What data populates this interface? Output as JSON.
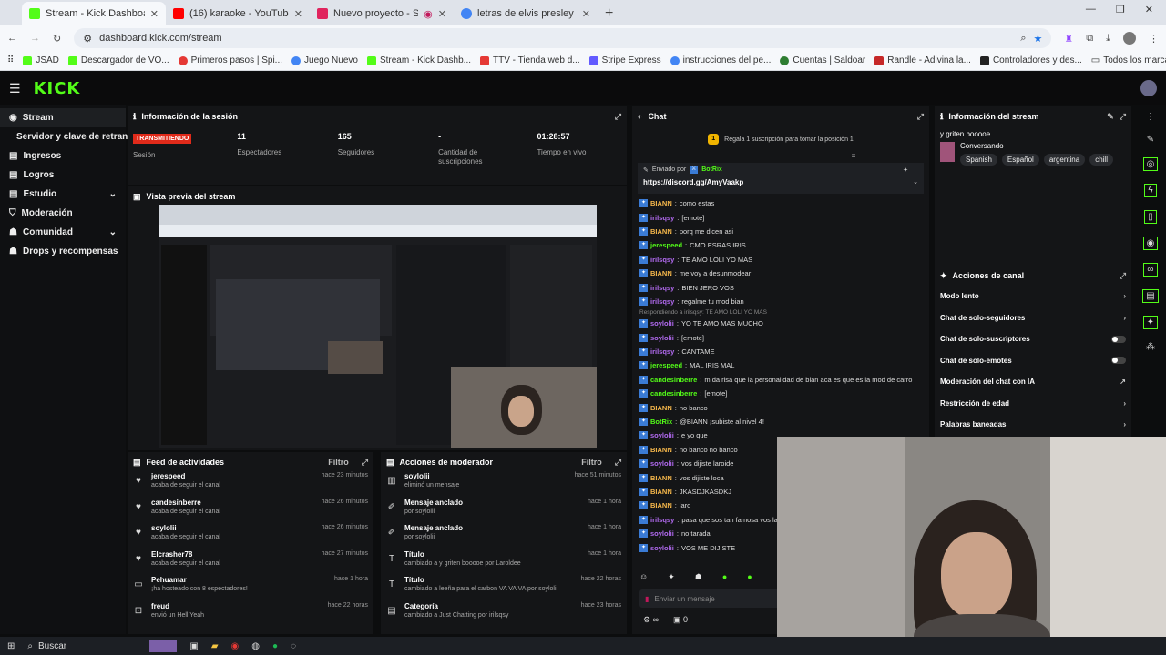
{
  "browser": {
    "tabs": [
      {
        "title": "Stream - Kick Dashboard",
        "color": "#53fc18",
        "active": true
      },
      {
        "title": "(16) karaoke - YouTube",
        "color": "#ff0000",
        "active": false
      },
      {
        "title": "Nuevo proyecto - Studio",
        "color": "#e0245e",
        "active": false
      },
      {
        "title": "letras de elvis presley can't help",
        "color": "#4285f4",
        "active": false
      }
    ],
    "url": "dashboard.kick.com/stream",
    "bookmarks": [
      "JSAD",
      "Descargador de VO...",
      "Primeros pasos | Spi...",
      "Juego Nuevo",
      "Stream - Kick Dashb...",
      "TTV - Tienda web d...",
      "Stripe Express",
      "instrucciones del pe...",
      "Cuentas | Saldoar",
      "Randle - Adivina la...",
      "Controladores y des..."
    ],
    "all_bookmarks": "Todos los marcadores"
  },
  "sidebar": {
    "items": [
      {
        "label": "Stream",
        "active": true,
        "chevron": false
      },
      {
        "label": "Servidor y clave de retransm",
        "active": false,
        "chevron": false
      },
      {
        "label": "Ingresos",
        "active": false,
        "chevron": false
      },
      {
        "label": "Logros",
        "active": false,
        "chevron": false
      },
      {
        "label": "Estudio",
        "active": false,
        "chevron": true
      },
      {
        "label": "Moderación",
        "active": false,
        "chevron": false
      },
      {
        "label": "Comunidad",
        "active": false,
        "chevron": true
      },
      {
        "label": "Drops y recompensas",
        "active": false,
        "chevron": false
      }
    ]
  },
  "session": {
    "title": "Información de la sesión",
    "live_badge": "TRANSMITIENDO",
    "session_label": "Sesión",
    "stats": [
      {
        "value": "11",
        "label": "Espectadores"
      },
      {
        "value": "165",
        "label": "Seguidores"
      },
      {
        "value": "-",
        "label": "Cantidad de suscripciones"
      },
      {
        "value": "01:28:57",
        "label": "Tiempo en vivo"
      }
    ]
  },
  "preview": {
    "title": "Vista previa del stream"
  },
  "feed": {
    "title": "Feed de actividades",
    "filter": "Filtro",
    "items": [
      {
        "icon": "heart",
        "name": "jerespeed",
        "sub": "acaba de seguir el canal",
        "time": "hace 23 minutos"
      },
      {
        "icon": "heart",
        "name": "candesinberre",
        "sub": "acaba de seguir el canal",
        "time": "hace 26 minutos"
      },
      {
        "icon": "heart",
        "name": "soylolii",
        "sub": "acaba de seguir el canal",
        "time": "hace 26 minutos"
      },
      {
        "icon": "heart",
        "name": "Elcrasher78",
        "sub": "acaba de seguir el canal",
        "time": "hace 27 minutos"
      },
      {
        "icon": "host",
        "name": "Pehuamar",
        "sub": "¡ha hosteado con 8 espectadores!",
        "time": "hace 1 hora"
      },
      {
        "icon": "gift",
        "name": "freud",
        "sub": "envió un Hell Yeah",
        "time": "hace 22 horas"
      }
    ]
  },
  "modactions": {
    "title": "Acciones de moderador",
    "filter": "Filtro",
    "items": [
      {
        "icon": "trash",
        "name": "soylolii",
        "sub": "eliminó un mensaje",
        "time": "hace 51 minutos"
      },
      {
        "icon": "pin",
        "name": "Mensaje anclado",
        "sub": "por soylolii",
        "time": "hace 1 hora"
      },
      {
        "icon": "pin",
        "name": "Mensaje anclado",
        "sub": "por soylolii",
        "time": "hace 1 hora"
      },
      {
        "icon": "title",
        "name": "Título",
        "sub": "cambiado a y griten booooe por Laroldee",
        "time": "hace 1 hora"
      },
      {
        "icon": "title",
        "name": "Título",
        "sub": "cambiado a leeña para el carbon VA VA VA por soylolii",
        "time": "hace 22 horas"
      },
      {
        "icon": "category",
        "name": "Categoría",
        "sub": "cambiado a Just Chatting por irilsqsy",
        "time": "hace 23 horas"
      }
    ]
  },
  "chat": {
    "title": "Chat",
    "sub_prompt": "Regala 1 suscripción para tomar la posición 1",
    "pinned_by": "Enviado por",
    "pinned_user": "BotRix",
    "pinned_link": "https://discord.gg/AmyVaakp",
    "messages": [
      {
        "user": "BIANN",
        "color": "#f7b84b",
        "text": "como estas"
      },
      {
        "user": "irilsqsy",
        "color": "#b36bf2",
        "text": "[emote]"
      },
      {
        "user": "BIANN",
        "color": "#f7b84b",
        "text": "porq me dicen asi"
      },
      {
        "user": "jerespeed",
        "color": "#53fc18",
        "text": "CMO ESRAS IRIS"
      },
      {
        "user": "irilsqsy",
        "color": "#b36bf2",
        "text": "TE AMO LOLI YO MAS"
      },
      {
        "user": "BIANN",
        "color": "#f7b84b",
        "text": "me voy a desunmodear"
      },
      {
        "user": "irilsqsy",
        "color": "#b36bf2",
        "text": "BIEN JERO VOS"
      },
      {
        "user": "irilsqsy",
        "color": "#b36bf2",
        "text": "regalme tu mod bian"
      },
      {
        "user": "soylolii",
        "color": "#b36bf2",
        "text": "YO TE AMO MAS MUCHO",
        "reply": "Respondiendo a irilsqsy: TE AMO LOLI YO MAS"
      },
      {
        "user": "soylolii",
        "color": "#b36bf2",
        "text": "[emote]"
      },
      {
        "user": "irilsqsy",
        "color": "#b36bf2",
        "text": "CANTAME"
      },
      {
        "user": "jerespeed",
        "color": "#53fc18",
        "text": "MAL IRIS MAL"
      },
      {
        "user": "candesinberre",
        "color": "#53fc18",
        "text": "m da risa que la personalidad de bian aca es que es la mod de carro"
      },
      {
        "user": "candesinberre",
        "color": "#53fc18",
        "text": "[emote]"
      },
      {
        "user": "BIANN",
        "color": "#f7b84b",
        "text": "no banco"
      },
      {
        "user": "BotRix",
        "color": "#53fc18",
        "text": "@BIANN ¡subiste al nivel 4!"
      },
      {
        "user": "soylolii",
        "color": "#b36bf2",
        "text": "e yo que"
      },
      {
        "user": "BIANN",
        "color": "#f7b84b",
        "text": "no banco no banco"
      },
      {
        "user": "soylolii",
        "color": "#b36bf2",
        "text": "vos dijiste laroide"
      },
      {
        "user": "BIANN",
        "color": "#f7b84b",
        "text": "vos dijiste loca"
      },
      {
        "user": "BIANN",
        "color": "#f7b84b",
        "text": "JKASDJKASDKJ"
      },
      {
        "user": "BIANN",
        "color": "#f7b84b",
        "text": "laro"
      },
      {
        "user": "irilsqsy",
        "color": "#b36bf2",
        "text": "pasa que sos tan famosa vos laro"
      },
      {
        "user": "soylolii",
        "color": "#b36bf2",
        "text": "no tarada"
      },
      {
        "user": "soylolii",
        "color": "#b36bf2",
        "text": "VOS ME DIJISTE"
      }
    ],
    "input_placeholder": "Enviar un mensaje",
    "footer_left": "∞",
    "footer_right": "0"
  },
  "streaminfo": {
    "title": "Información del stream",
    "stream_title": "y griten booooe",
    "category": "Conversando",
    "tags": [
      "Spanish",
      "Español",
      "argentina",
      "chill"
    ]
  },
  "channel_actions": {
    "title": "Acciones de canal",
    "rows": [
      {
        "label": "Modo lento",
        "control": "chevron"
      },
      {
        "label": "Chat de solo-seguidores",
        "control": "chevron"
      },
      {
        "label": "Chat de solo-suscriptores",
        "control": "toggle"
      },
      {
        "label": "Chat de solo-emotes",
        "control": "toggle"
      },
      {
        "label": "Moderación del chat con IA",
        "control": "external"
      },
      {
        "label": "Restricción de edad",
        "control": "chevron"
      },
      {
        "label": "Palabras baneadas",
        "control": "chevron"
      }
    ]
  },
  "taskbar": {
    "search": "Buscar"
  }
}
